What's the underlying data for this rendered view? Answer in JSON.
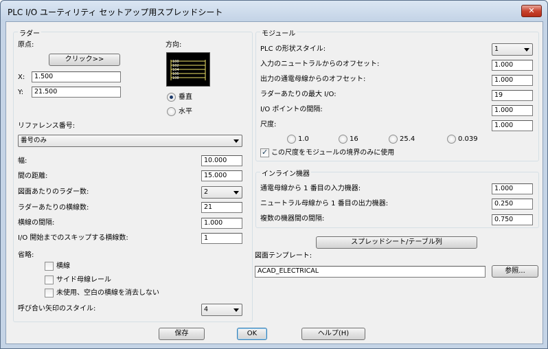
{
  "window": {
    "title": "PLC I/O ユーティリティ セットアップ用スプレッドシート",
    "close_glyph": "✕"
  },
  "ladder": {
    "group_label": "ラダー",
    "origin_label": "原点:",
    "click_button": "クリック>>",
    "x_label": "X:",
    "x_value": "1.500",
    "y_label": "Y:",
    "y_value": "21.500",
    "direction_label": "方向:",
    "vertical_label": "垂直",
    "horizontal_label": "水平",
    "reference_label": "リファレンス番号:",
    "reference_value": "番号のみ",
    "width_label": "幅:",
    "width_value": "10.000",
    "spacing_label": "間の距離:",
    "spacing_value": "15.000",
    "ladders_per_drawing_label": "図面あたりのラダー数:",
    "ladders_per_drawing_value": "2",
    "rungs_per_ladder_label": "ラダーあたりの横線数:",
    "rungs_per_ladder_value": "21",
    "rung_spacing_label": "横線の間隔:",
    "rung_spacing_value": "1.000",
    "skip_rungs_label": "I/O 開始までのスキップする横線数:",
    "skip_rungs_value": "1",
    "omit_label": "省略:",
    "omit_rungs_label": "横線",
    "omit_rails_label": "サイド母線レール",
    "omit_unused_label": "未使用、空白の横線を消去しない",
    "arrow_style_label": "呼び合い矢印のスタイル:",
    "arrow_style_value": "4"
  },
  "module": {
    "group_label": "モジュール",
    "plc_style_label": "PLC の形状スタイル:",
    "plc_style_value": "1",
    "input_offset_label": "入力のニュートラルからのオフセット:",
    "input_offset_value": "1.000",
    "output_offset_label": "出力の通電母線からのオフセット:",
    "output_offset_value": "1.000",
    "max_io_label": "ラダーあたりの最大 I/O:",
    "max_io_value": "19",
    "io_point_spacing_label": "I/O ポイントの間隔:",
    "io_point_spacing_value": "1.000",
    "scale_label": "尺度:",
    "scale_value": "1.000",
    "scale_options": [
      "1.0",
      "16",
      "25.4",
      "0.039"
    ],
    "scale_only_module_label": "この尺度をモジュールの境界のみに使用"
  },
  "inline": {
    "group_label": "インライン機器",
    "first_input_label": "通電母線から 1 番目の入力機器:",
    "first_input_value": "1.000",
    "first_output_label": "ニュートラル母線から 1 番目の出力機器:",
    "first_output_value": "0.250",
    "multi_spacing_label": "複数の機器間の間隔:",
    "multi_spacing_value": "0.750"
  },
  "spreadsheet_button": "スプレッドシート/テーブル列",
  "template": {
    "label": "図面テンプレート:",
    "value": "ACAD_ELECTRICAL",
    "browse_button": "参照..."
  },
  "footer": {
    "save": "保存",
    "ok": "OK",
    "help": "ヘルプ(H)"
  },
  "preview_ticks": [
    "100",
    "102",
    "104",
    "106",
    "108"
  ],
  "colors": {
    "accent": "#1d3a6b",
    "preview_line": "#f2e66a",
    "close": "#c8432f"
  }
}
